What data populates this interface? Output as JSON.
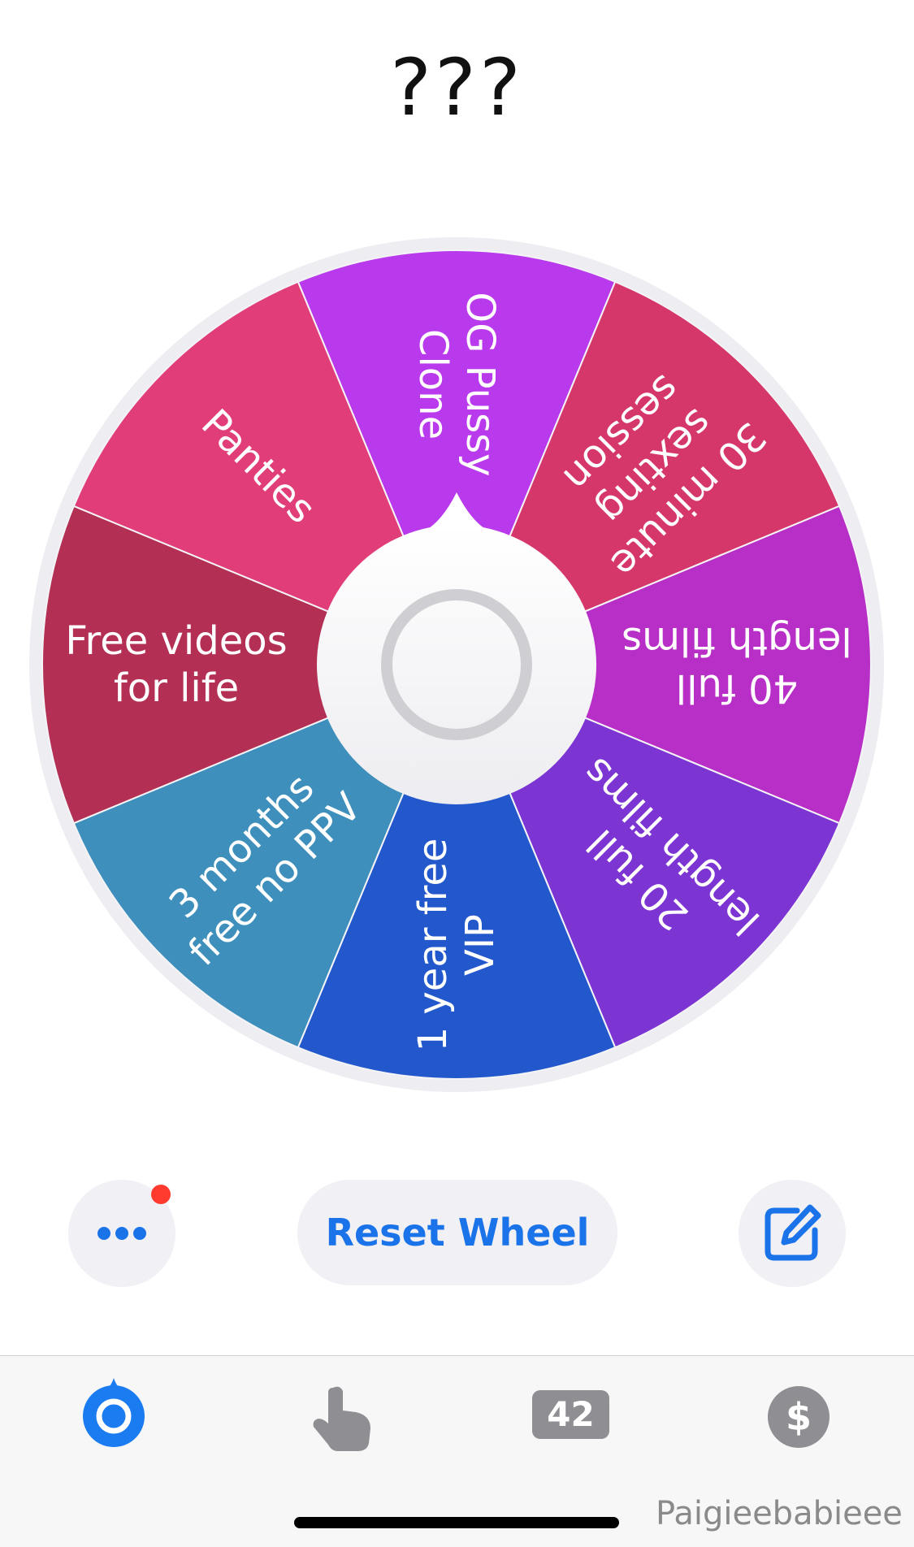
{
  "wheel": {
    "title": "???",
    "segments": [
      {
        "label": [
          "OG Pussy",
          "Clone"
        ],
        "color": "#b93aec"
      },
      {
        "label": [
          "30 minute",
          "sexting",
          "session"
        ],
        "color": "#d6376b"
      },
      {
        "label": [
          "40 full",
          "length films"
        ],
        "color": "#b72fc6"
      },
      {
        "label": [
          "20 full",
          "length films"
        ],
        "color": "#7c35d2"
      },
      {
        "label": [
          "1 year free",
          "VIP"
        ],
        "color": "#2358cc"
      },
      {
        "label": [
          "3 months",
          "free no PPV"
        ],
        "color": "#3e8fbb"
      },
      {
        "label": [
          "Free videos",
          "for life"
        ],
        "color": "#b32f54"
      },
      {
        "label": [
          "Panties"
        ],
        "color": "#e13e79"
      }
    ],
    "rim_color": "#ededf2"
  },
  "controls": {
    "more_icon": "ellipsis-icon",
    "reset_label": "Reset Wheel",
    "edit_icon": "edit-icon",
    "accent_color": "#1a73e8"
  },
  "tabbar": {
    "tabs": [
      {
        "name": "wheel",
        "icon": "wheel-icon",
        "active": true
      },
      {
        "name": "tap",
        "icon": "hand-pointer-icon"
      },
      {
        "name": "number",
        "icon": "number-badge-icon",
        "label": "42"
      },
      {
        "name": "money",
        "icon": "dollar-icon"
      }
    ]
  },
  "watermark": "Paigieebabieee"
}
